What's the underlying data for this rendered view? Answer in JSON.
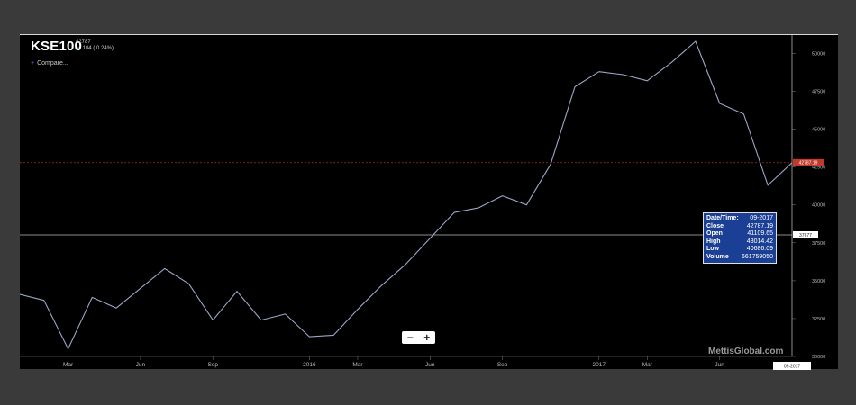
{
  "header": {
    "symbol": "KSE100",
    "last_value": "42787",
    "change": "104 ( 0.24%)",
    "change_arrow": "▲",
    "compare_label": "Compare..."
  },
  "zoom": {
    "minus": "−",
    "plus": "+"
  },
  "watermark": "MettisGlobal.com",
  "tooltip": {
    "rows": [
      {
        "k": "Date/Time:",
        "v": "09-2017"
      },
      {
        "k": "Close",
        "v": "42787.19"
      },
      {
        "k": "Open",
        "v": "41109.65"
      },
      {
        "k": "High",
        "v": "43014.42"
      },
      {
        "k": "Low",
        "v": "40686.09"
      },
      {
        "k": "Volume",
        "v": "661759050"
      }
    ]
  },
  "colors": {
    "line": "#9aa6c6",
    "last_price": "#c0392b",
    "crosshair": "#bdbdbd",
    "tooltip_bg": "#1b3f95"
  },
  "chart_data": {
    "type": "line",
    "title": "",
    "xlabel": "",
    "ylabel": "",
    "x_ticks": [
      "Mar",
      "Jun",
      "Sep",
      "2016",
      "Mar",
      "Jun",
      "Sep",
      "2017",
      "Mar",
      "Jun"
    ],
    "y_ticks": [
      30000,
      32500,
      35000,
      37500,
      40000,
      42500,
      45000,
      47500,
      50000
    ],
    "ylim": [
      30000,
      50800
    ],
    "last_price_label": "42787.19",
    "crosshair_y_label": "37677",
    "crosshair_x_label": "09-2017",
    "series": [
      {
        "values": [
          {
            "x": "2015-01",
            "y": 34100
          },
          {
            "x": "2015-02",
            "y": 33700
          },
          {
            "x": "2015-03",
            "y": 30500
          },
          {
            "x": "2015-04",
            "y": 33900
          },
          {
            "x": "2015-05",
            "y": 33200
          },
          {
            "x": "2015-06",
            "y": 34500
          },
          {
            "x": "2015-07",
            "y": 35800
          },
          {
            "x": "2015-08",
            "y": 34800
          },
          {
            "x": "2015-09",
            "y": 32400
          },
          {
            "x": "2015-10",
            "y": 34300
          },
          {
            "x": "2015-11",
            "y": 32400
          },
          {
            "x": "2015-12",
            "y": 32800
          },
          {
            "x": "2016-01",
            "y": 31300
          },
          {
            "x": "2016-02",
            "y": 31400
          },
          {
            "x": "2016-03",
            "y": 33100
          },
          {
            "x": "2016-04",
            "y": 34700
          },
          {
            "x": "2016-05",
            "y": 36100
          },
          {
            "x": "2016-06",
            "y": 37800
          },
          {
            "x": "2016-07",
            "y": 39500
          },
          {
            "x": "2016-08",
            "y": 39800
          },
          {
            "x": "2016-09",
            "y": 40600
          },
          {
            "x": "2016-10",
            "y": 40000
          },
          {
            "x": "2016-11",
            "y": 42700
          },
          {
            "x": "2016-12",
            "y": 47800
          },
          {
            "x": "2017-01",
            "y": 48800
          },
          {
            "x": "2017-02",
            "y": 48600
          },
          {
            "x": "2017-03",
            "y": 48200
          },
          {
            "x": "2017-04",
            "y": 49400
          },
          {
            "x": "2017-05",
            "y": 50800
          },
          {
            "x": "2017-06",
            "y": 46700
          },
          {
            "x": "2017-07",
            "y": 46000
          },
          {
            "x": "2017-08",
            "y": 41300
          },
          {
            "x": "2017-09",
            "y": 42787
          }
        ]
      }
    ]
  }
}
